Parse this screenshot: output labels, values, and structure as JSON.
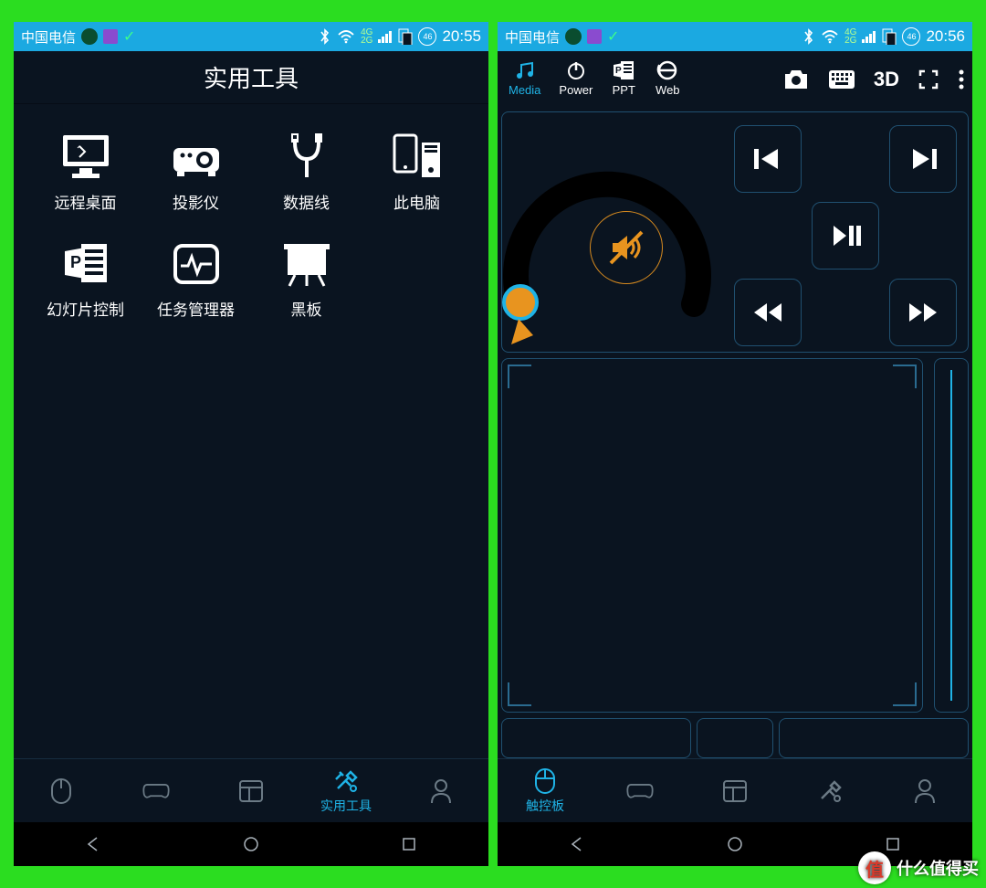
{
  "left": {
    "status": {
      "carrier": "中国电信",
      "time": "20:55",
      "sig1": "4G",
      "sig2": "2G",
      "battery": "46"
    },
    "header": {
      "title": "实用工具"
    },
    "tools": [
      {
        "name": "remote-desktop",
        "label": "远程桌面"
      },
      {
        "name": "projector",
        "label": "投影仪"
      },
      {
        "name": "data-cable",
        "label": "数据线"
      },
      {
        "name": "this-pc",
        "label": "此电脑"
      },
      {
        "name": "slide-control",
        "label": "幻灯片控制"
      },
      {
        "name": "task-manager",
        "label": "任务管理器"
      },
      {
        "name": "blackboard",
        "label": "黑板"
      }
    ],
    "tabs": {
      "active_index": 3,
      "items": [
        {
          "name": "touchpad",
          "label": ""
        },
        {
          "name": "gamepad",
          "label": ""
        },
        {
          "name": "layouts",
          "label": ""
        },
        {
          "name": "tools",
          "label": "实用工具"
        },
        {
          "name": "profile",
          "label": ""
        }
      ]
    }
  },
  "right": {
    "status": {
      "carrier": "中国电信",
      "time": "20:56",
      "sig1": "4G",
      "sig2": "2G",
      "battery": "46"
    },
    "modes": [
      {
        "name": "media",
        "label": "Media",
        "active": true
      },
      {
        "name": "power",
        "label": "Power"
      },
      {
        "name": "ppt",
        "label": "PPT"
      },
      {
        "name": "web",
        "label": "Web"
      }
    ],
    "actions": {
      "threeD": "3D"
    },
    "media": {
      "muted": true
    },
    "tabs": {
      "active_index": 0,
      "items": [
        {
          "name": "touchpad",
          "label": "触控板"
        },
        {
          "name": "gamepad",
          "label": ""
        },
        {
          "name": "layouts",
          "label": ""
        },
        {
          "name": "tools",
          "label": ""
        },
        {
          "name": "profile",
          "label": ""
        }
      ]
    }
  },
  "watermark": {
    "badge": "值",
    "text": "什么值得买"
  }
}
